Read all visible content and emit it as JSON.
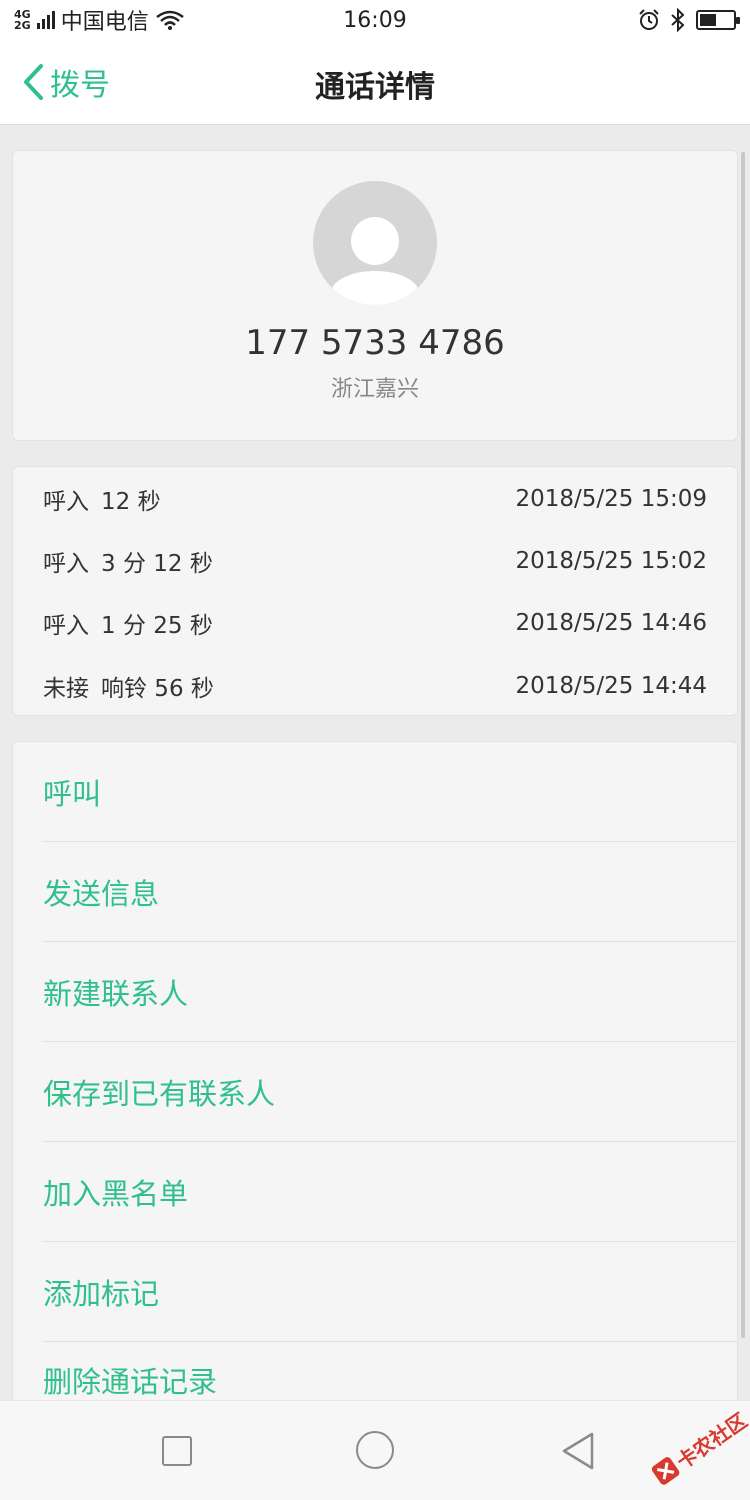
{
  "status_bar": {
    "network_top": "4G",
    "network_bottom": "2G",
    "carrier": "中国电信",
    "time": "16:09",
    "icons": [
      "wifi-icon",
      "alarm-icon",
      "bluetooth-icon",
      "battery-icon"
    ],
    "battery_level": 0.5
  },
  "header": {
    "back_label": "拨号",
    "title": "通话详情"
  },
  "contact": {
    "phone_number": "177 5733 4786",
    "location": "浙江嘉兴"
  },
  "call_history": [
    {
      "type": "呼入",
      "duration": "12 秒",
      "datetime": "2018/5/25 15:09"
    },
    {
      "type": "呼入",
      "duration": "3 分 12 秒",
      "datetime": "2018/5/25 15:02"
    },
    {
      "type": "呼入",
      "duration": "1 分 25 秒",
      "datetime": "2018/5/25 14:46"
    },
    {
      "type": "未接",
      "duration": "响铃 56 秒",
      "datetime": "2018/5/25 14:44"
    }
  ],
  "actions": [
    {
      "label": "呼叫"
    },
    {
      "label": "发送信息"
    },
    {
      "label": "新建联系人"
    },
    {
      "label": "保存到已有联系人"
    },
    {
      "label": "加入黑名单"
    },
    {
      "label": "添加标记"
    },
    {
      "label": "删除通话记录"
    }
  ],
  "watermark": {
    "text": "卡农社区"
  },
  "colors": {
    "accent": "#2fc08c",
    "background": "#ebebeb",
    "card": "#f5f5f5",
    "watermark": "#d93a2f"
  }
}
